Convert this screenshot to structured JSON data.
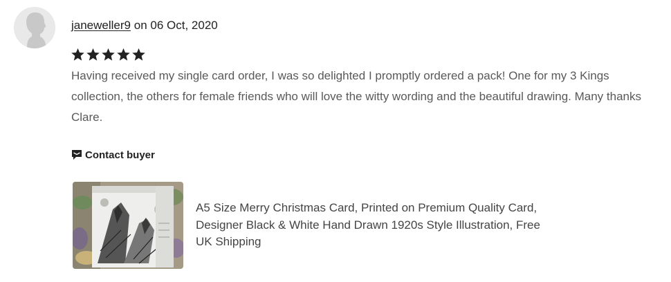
{
  "review": {
    "username": "janeweller9",
    "date_prefix": "on",
    "date": "06 Oct, 2020",
    "rating": 5,
    "text": "Having received my single card order, I was so delighted I promptly ordered a pack! One for my 3 Kings collection, the others for female friends who will love the witty wording and the beautiful drawing. Many thanks Clare.",
    "contact_label": "Contact buyer"
  },
  "listing": {
    "title": "A5 Size Merry Christmas Card, Printed on Premium Quality Card, Designer Black & White Hand Drawn 1920s Style Illustration, Free UK Shipping"
  },
  "icons": {
    "avatar": "default-avatar-icon",
    "star": "star-icon",
    "contact": "message-icon"
  },
  "colors": {
    "star": "#222222",
    "body_text": "#595959",
    "link_text": "#222222"
  }
}
